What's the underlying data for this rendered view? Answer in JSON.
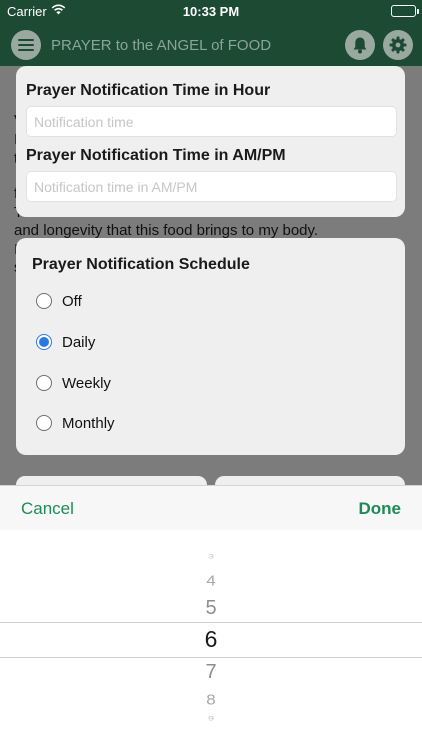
{
  "status_bar": {
    "carrier": "Carrier",
    "time": "10:33 PM"
  },
  "nav": {
    "title": "PRAYER to the ANGEL of FOOD"
  },
  "background": {
    "line": "and longevity that this food brings to my body.",
    "fragments": [
      "V",
      "I",
      "t",
      "f",
      "T",
      "I",
      "s"
    ]
  },
  "time_card": {
    "hour_label": "Prayer Notification Time in Hour",
    "hour_placeholder": "Notification time",
    "ampm_label": "Prayer Notification Time in AM/PM",
    "ampm_placeholder": "Notification time in AM/PM"
  },
  "schedule": {
    "title": "Prayer Notification Schedule",
    "options": [
      "Off",
      "Daily",
      "Weekly",
      "Monthly"
    ],
    "selected": "Daily"
  },
  "toolbar": {
    "cancel": "Cancel",
    "done": "Done"
  },
  "picker": {
    "values": [
      "3",
      "4",
      "5",
      "6",
      "7",
      "8",
      "9"
    ],
    "selected": "6"
  }
}
